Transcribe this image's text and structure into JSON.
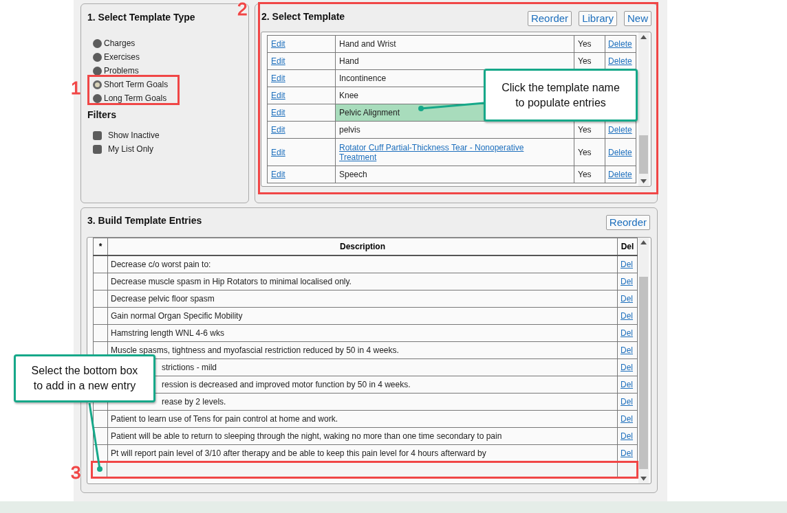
{
  "template_type": {
    "title": "1. Select Template Type",
    "options": [
      {
        "label": "Charges",
        "selected": false
      },
      {
        "label": "Exercises",
        "selected": false
      },
      {
        "label": "Problems",
        "selected": false
      },
      {
        "label": "Short Term Goals",
        "selected": true
      },
      {
        "label": "Long Term Goals",
        "selected": false
      }
    ],
    "filters_title": "Filters",
    "filters": [
      {
        "label": "Show Inactive",
        "checked": false
      },
      {
        "label": "My List Only",
        "checked": false
      }
    ]
  },
  "select_template": {
    "title": "2. Select Template",
    "buttons": [
      "Reorder",
      "Library",
      "New"
    ],
    "rows": [
      {
        "edit": "Edit",
        "name": "Hand and Wrist",
        "linked": false,
        "highlighted": false,
        "active": "Yes",
        "delete": "Delete"
      },
      {
        "edit": "Edit",
        "name": "Hand",
        "linked": false,
        "highlighted": false,
        "active": "Yes",
        "delete": "Delete"
      },
      {
        "edit": "Edit",
        "name": "Incontinence",
        "linked": false,
        "highlighted": false
      },
      {
        "edit": "Edit",
        "name": "Knee",
        "linked": false,
        "highlighted": false
      },
      {
        "edit": "Edit",
        "name": "Pelvic Alignment",
        "linked": false,
        "highlighted": true
      },
      {
        "edit": "Edit",
        "name": "pelvis",
        "linked": false,
        "highlighted": false,
        "active": "Yes",
        "delete": "Delete"
      },
      {
        "edit": "Edit",
        "name": "Rotator Cuff Partial-Thickness Tear - Nonoperative Treatment",
        "linked": true,
        "highlighted": false,
        "active": "Yes",
        "delete": "Delete"
      },
      {
        "edit": "Edit",
        "name": "Speech",
        "linked": false,
        "highlighted": false,
        "active": "Yes",
        "delete": "Delete"
      }
    ]
  },
  "entries": {
    "title": "3. Build Template Entries",
    "reorder": "Reorder",
    "columns": [
      "*",
      "Description",
      "Del"
    ],
    "rows": [
      {
        "description": "Decrease c/o worst pain to:",
        "delete": "Del",
        "covered": false
      },
      {
        "description": "Decrease muscle spasm in Hip Rotators to minimal localised only.",
        "delete": "Del",
        "covered": false
      },
      {
        "description": "Decrease pelvic floor spasm",
        "delete": "Del",
        "covered": false
      },
      {
        "description": "Gain normal Organ Specific Mobility",
        "delete": "Del",
        "covered": false
      },
      {
        "description": "Hamstring length WNL 4-6 wks",
        "delete": "Del",
        "covered": false
      },
      {
        "description": "Muscle spasms, tightness and myofascial restriction reduced by 50 in 4 weeks.",
        "delete": "Del",
        "covered": false
      },
      {
        "description": "strictions - mild",
        "delete": "Del",
        "covered": true
      },
      {
        "description": "ression is decreased and improved motor function by 50 in 4 weeks.",
        "delete": "Del",
        "covered": true
      },
      {
        "description": "rease by 2 levels.",
        "delete": "Del",
        "covered": true
      },
      {
        "description": "Patient to learn use of Tens for pain control at home and work.",
        "delete": "Del",
        "covered": false
      },
      {
        "description": "Patient will be able to return to sleeping through the night, waking no more than one time secondary to pain",
        "delete": "Del",
        "covered": false
      },
      {
        "description": "Pt will report pain level of 3/10 after therapy and be able to keep this pain level for 4 hours afterward by",
        "delete": "Del",
        "covered": false
      }
    ]
  },
  "callouts": [
    {
      "text": "Click the template name to populate entries"
    },
    {
      "text": "Select the bottom box to add in a new entry"
    }
  ],
  "step_markers": [
    "1",
    "2",
    "3"
  ]
}
